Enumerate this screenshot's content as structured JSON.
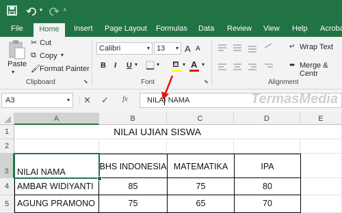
{
  "quick_access": {
    "save_icon": "save-icon",
    "undo_icon": "undo-icon",
    "redo_icon": "redo-icon",
    "customize_icon": "customize-icon"
  },
  "tabs": [
    "File",
    "Home",
    "Insert",
    "Page Layout",
    "Formulas",
    "Data",
    "Review",
    "View",
    "Help",
    "Acroba"
  ],
  "active_tab": "Home",
  "clipboard": {
    "paste": "Paste",
    "cut": "Cut",
    "copy": "Copy",
    "format_painter": "Format Painter",
    "group": "Clipboard"
  },
  "font": {
    "name": "Calibri",
    "size": "13",
    "bold": "B",
    "italic": "I",
    "underline": "U",
    "group": "Font",
    "grow": "A",
    "shrink": "A"
  },
  "alignment": {
    "wrap_text": "Wrap Text",
    "merge": "Merge & Centr",
    "group": "Alignment"
  },
  "name_box": "A3",
  "formula": {
    "value": "NILAI NAMA",
    "fx": "fx"
  },
  "watermark": "TermasMedia",
  "columns": [
    "A",
    "B",
    "C",
    "D",
    "E"
  ],
  "rows": [
    "1",
    "2",
    "3",
    "4",
    "5"
  ],
  "sheet": {
    "title": "NILAI UJIAN SISWA",
    "header": [
      "NILAI NAMA",
      "BHS INDONESIA",
      "MATEMATIKA",
      "IPA"
    ],
    "data": [
      [
        "AMBAR WIDIYANTI",
        "85",
        "75",
        "80"
      ],
      [
        "AGUNG PRAMONO",
        "75",
        "65",
        "70"
      ]
    ]
  },
  "colors": {
    "accent": "#217346",
    "arrow": "#e81010"
  }
}
